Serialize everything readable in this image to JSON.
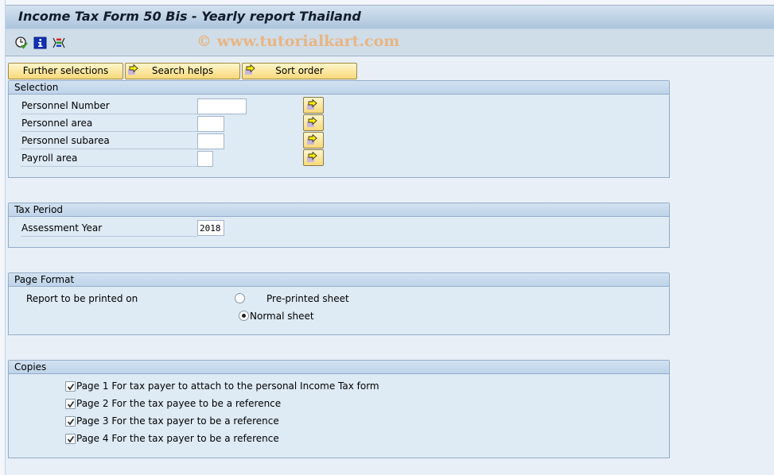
{
  "window": {
    "title": "Income Tax Form 50 Bis - Yearly report Thailand",
    "watermark": "© www.tutorialkart.com"
  },
  "toolbar": {
    "icons": [
      "execute-icon",
      "info-icon",
      "selection-options-icon"
    ]
  },
  "buttons": {
    "further_selections": "Further selections",
    "search_helps": "Search helps",
    "sort_order": "Sort order"
  },
  "selection": {
    "title": "Selection",
    "fields": [
      {
        "label": "Personnel Number",
        "value": ""
      },
      {
        "label": "Personnel area",
        "value": ""
      },
      {
        "label": "Personnel subarea",
        "value": ""
      },
      {
        "label": "Payroll area",
        "value": ""
      }
    ]
  },
  "tax_period": {
    "title": "Tax Period",
    "assessment_year_label": "Assessment Year",
    "assessment_year_value": "2018"
  },
  "page_format": {
    "title": "Page Format",
    "label": "Report to be printed on",
    "options": [
      {
        "label": "Pre-printed sheet",
        "selected": false
      },
      {
        "label": "Normal sheet",
        "selected": true
      }
    ]
  },
  "copies": {
    "title": "Copies",
    "items": [
      {
        "label": "Page 1 For tax payer to attach to the personal Income Tax form",
        "checked": true
      },
      {
        "label": "Page 2 For the tax payee to be a reference",
        "checked": true
      },
      {
        "label": "Page 3 For the tax payer to be a reference",
        "checked": true
      },
      {
        "label": "Page 4 For the tax payer to be a reference",
        "checked": true
      }
    ]
  }
}
